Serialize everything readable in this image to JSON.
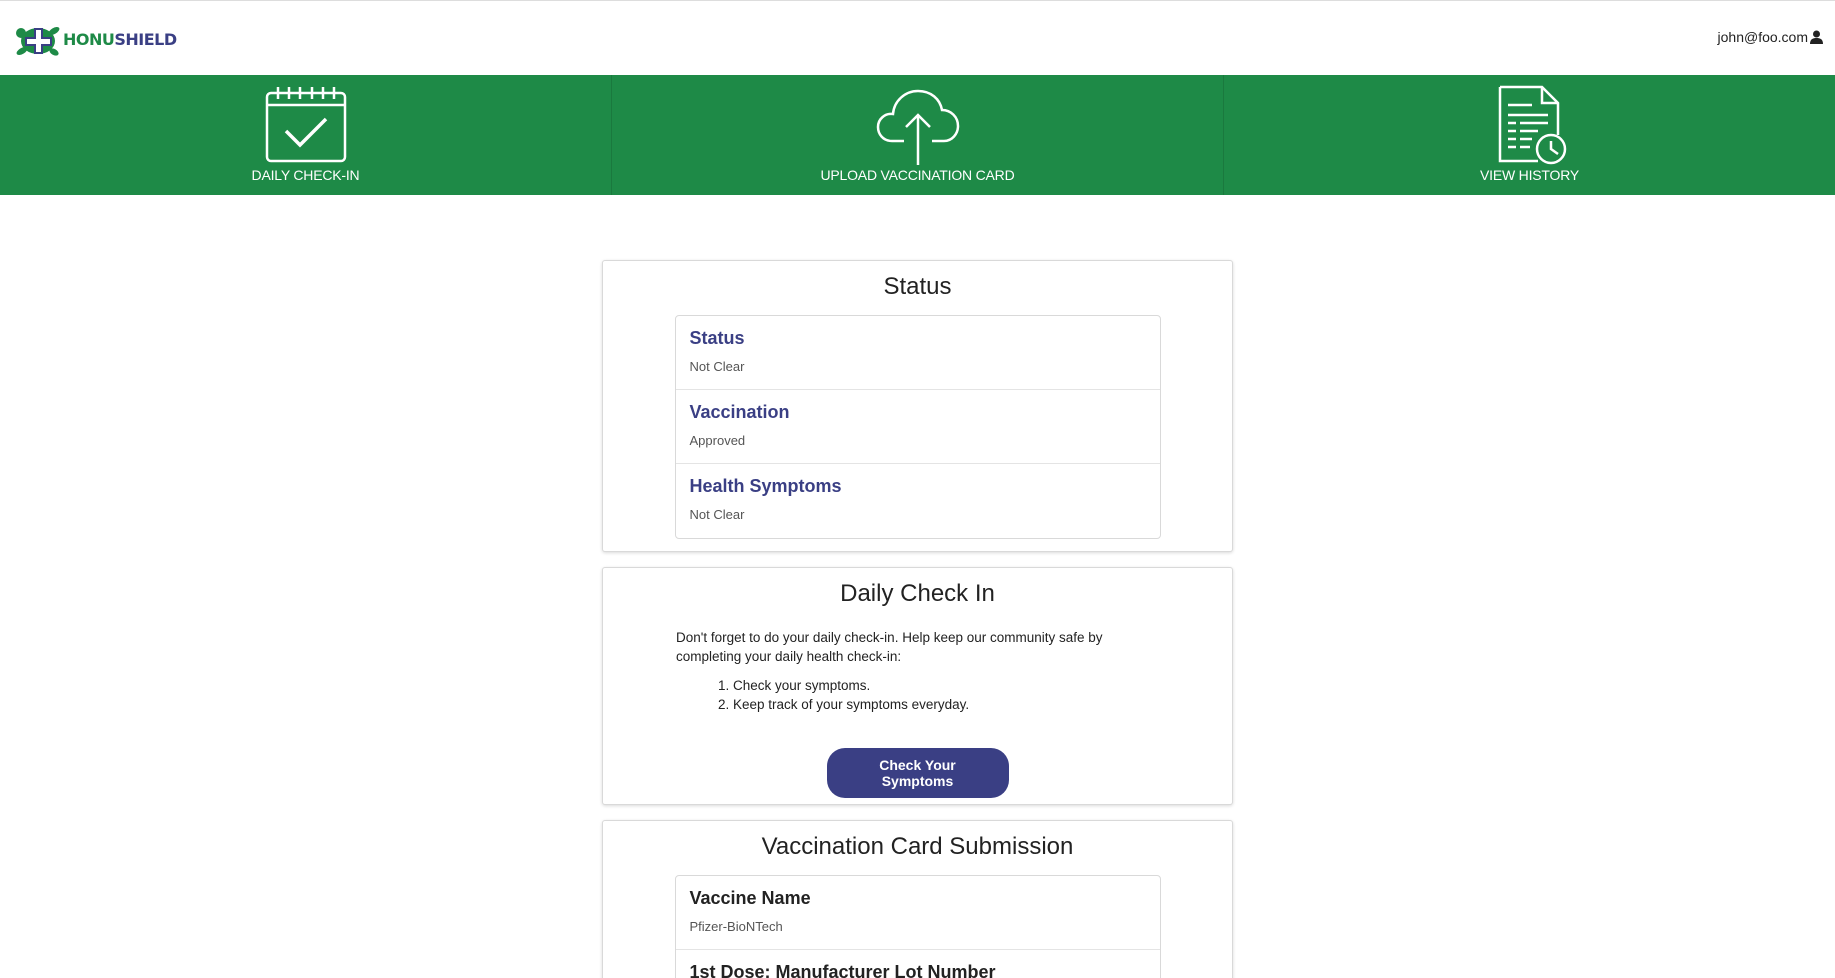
{
  "header": {
    "logo_part1": "HONU",
    "logo_part2": "SHIELD",
    "user_email": "john@foo.com"
  },
  "nav": {
    "items": [
      {
        "label": "DAILY CHECK-IN",
        "icon": "calendar-check-icon"
      },
      {
        "label": "UPLOAD VACCINATION CARD",
        "icon": "cloud-upload-icon"
      },
      {
        "label": "VIEW HISTORY",
        "icon": "document-clock-icon"
      }
    ]
  },
  "status_card": {
    "title": "Status",
    "rows": [
      {
        "label": "Status",
        "value": "Not Clear"
      },
      {
        "label": "Vaccination",
        "value": "Approved"
      },
      {
        "label": "Health Symptoms",
        "value": "Not Clear"
      }
    ]
  },
  "checkin_card": {
    "title": "Daily Check In",
    "text": "Don't forget to do your daily check-in. Help keep our community safe by completing your daily health check-in:",
    "steps": [
      "1. Check your symptoms.",
      "2. Keep track of your symptoms everyday."
    ],
    "button_label": "Check Your Symptoms"
  },
  "vaccination_card": {
    "title": "Vaccination Card Submission",
    "rows": [
      {
        "label": "Vaccine Name",
        "value": "Pfizer-BioNTech"
      },
      {
        "label": "1st Dose: Manufacturer Lot Number",
        "value": ""
      }
    ]
  },
  "colors": {
    "brand_green": "#1e8a47",
    "brand_navy": "#3a3f84"
  }
}
